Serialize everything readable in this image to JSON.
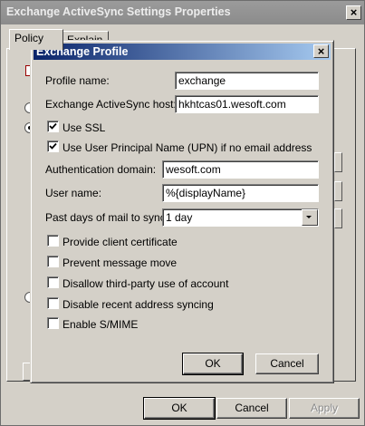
{
  "outer_window": {
    "title": "Exchange ActiveSync Settings Properties",
    "tabs": [
      "Policy",
      "Explain"
    ],
    "buttons": {
      "ok": "OK",
      "cancel": "Cancel",
      "apply": "Apply"
    }
  },
  "dialog": {
    "title": "Exchange Profile",
    "profile_name": {
      "label": "Profile name:",
      "value": "exchange"
    },
    "host": {
      "label": "Exchange ActiveSync host:",
      "value": "hkhtcas01.wesoft.com"
    },
    "use_ssl": {
      "label": "Use SSL",
      "checked": true
    },
    "use_upn": {
      "label": "Use User Principal Name (UPN) if no email address",
      "checked": true
    },
    "auth_domain": {
      "label": "Authentication domain:",
      "value": "wesoft.com"
    },
    "user_name": {
      "label": "User name:",
      "value": "%{displayName}"
    },
    "past_days": {
      "label": "Past days of mail to sync:",
      "value": "1 day"
    },
    "options": [
      {
        "label": "Provide client certificate",
        "checked": false
      },
      {
        "label": "Prevent message move",
        "checked": false
      },
      {
        "label": "Disallow third-party use of account",
        "checked": false
      },
      {
        "label": "Disable recent address syncing",
        "checked": false
      },
      {
        "label": "Enable S/MIME",
        "checked": false
      }
    ],
    "buttons": {
      "ok": "OK",
      "cancel": "Cancel"
    }
  }
}
